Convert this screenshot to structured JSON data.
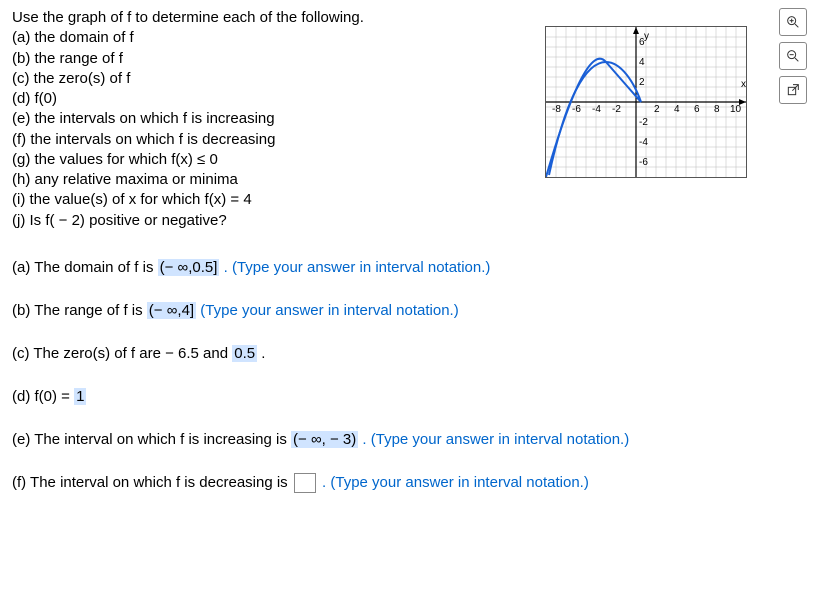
{
  "question": {
    "prompt": "Use the graph of f to determine each of the following.",
    "parts": [
      "(a) the domain of f",
      "(b) the range of f",
      "(c) the zero(s) of f",
      "(d) f(0)",
      "(e) the intervals on which f is increasing",
      "(f) the intervals on which f is decreasing",
      "(g) the values for which f(x) ≤ 0",
      "(h) any relative maxima or minima",
      "(i) the value(s) of x for which f(x) = 4",
      "(j) Is f( − 2) positive or negative?"
    ]
  },
  "graph": {
    "x_label": "x",
    "y_label": "y",
    "x_ticks": [
      -8,
      -6,
      -4,
      -2,
      2,
      4,
      6,
      8,
      10
    ],
    "y_ticks": [
      -6,
      -4,
      -2,
      2,
      4,
      6
    ],
    "curve_note": "downward parabola, vertex near (-3,4), zeros near -6.5 and 0.5, domain ends at 0.5"
  },
  "answers": {
    "a": {
      "label": "(a) The domain of f is",
      "value": "(− ∞,0.5]",
      "hint": ". (Type your answer in interval notation.)"
    },
    "b": {
      "label": "(b) The range of f is",
      "value": "(− ∞,4]",
      "hint": " (Type your answer in interval notation.)"
    },
    "c": {
      "label": "(c) The zero(s) of f are ",
      "plain": " − 6.5 and ",
      "value": "0.5",
      "tail": " ."
    },
    "d": {
      "label": "(d) f(0) = ",
      "value": "1"
    },
    "e": {
      "label": "(e) The interval on which f is increasing is",
      "value": "(− ∞, − 3)",
      "hint": ". (Type your answer in interval notation.)"
    },
    "f": {
      "label": "(f) The interval on which f is decreasing is",
      "hint": ". (Type your answer in interval notation.)"
    }
  },
  "tools": {
    "zoom_in": "zoom-in-icon",
    "zoom_out": "zoom-out-icon",
    "popout": "popout-icon"
  }
}
